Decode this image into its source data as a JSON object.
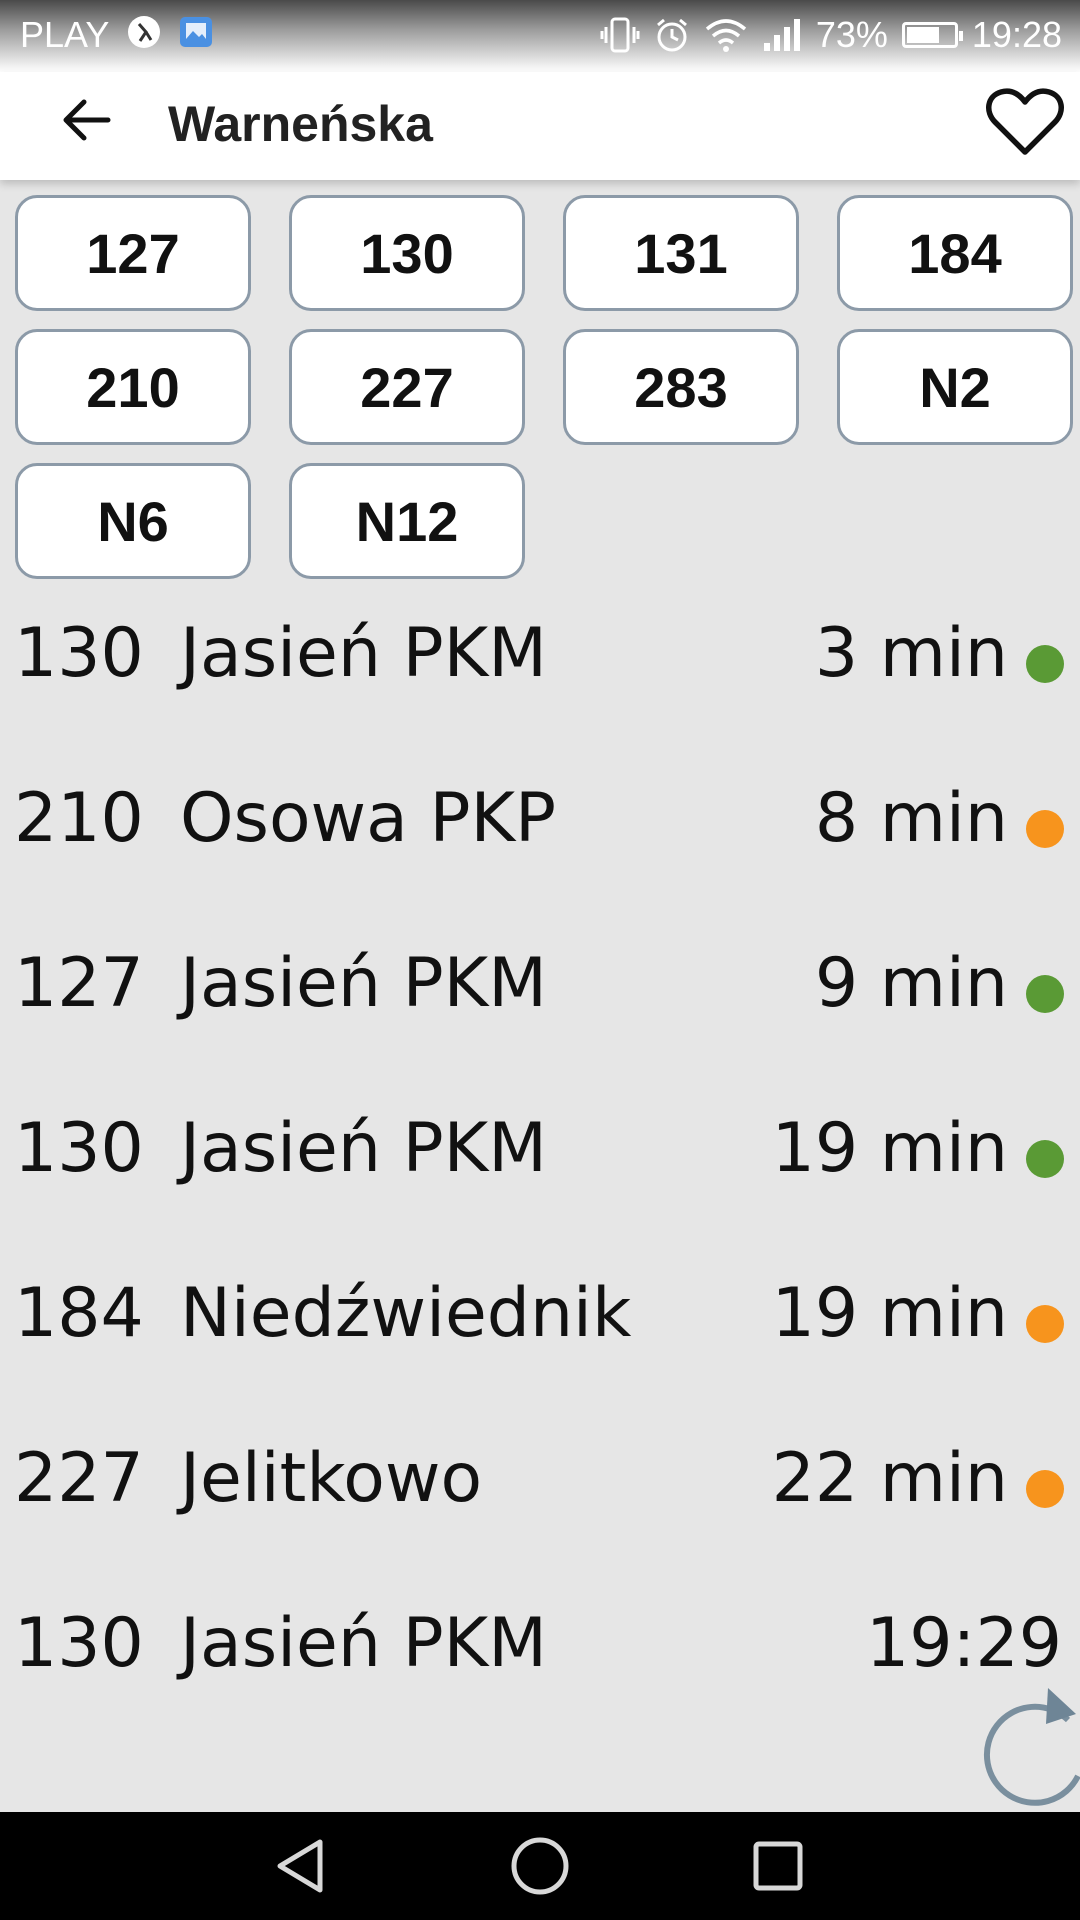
{
  "status_bar": {
    "carrier": "PLAY",
    "battery_percent": "73%",
    "battery_level": 0.73,
    "time": "19:28",
    "icons": [
      "cat-app-icon",
      "gallery-icon",
      "vibrate-icon",
      "alarm-icon",
      "wifi-icon",
      "signal-icon",
      "battery-icon"
    ]
  },
  "app_bar": {
    "title": "Warneńska",
    "back_icon": "arrow-left-icon",
    "favorite_icon": "heart-outline-icon"
  },
  "lines": [
    "127",
    "130",
    "131",
    "184",
    "210",
    "227",
    "283",
    "N2",
    "N6",
    "N12"
  ],
  "departures": [
    {
      "line": "130",
      "destination": "Jasień PKM",
      "time": "3 min",
      "status_color": "#5a9a35"
    },
    {
      "line": "210",
      "destination": "Osowa PKP",
      "time": "8 min",
      "status_color": "#f7941d"
    },
    {
      "line": "127",
      "destination": "Jasień PKM",
      "time": "9 min",
      "status_color": "#5a9a35"
    },
    {
      "line": "130",
      "destination": "Jasień PKM",
      "time": "19 min",
      "status_color": "#5a9a35"
    },
    {
      "line": "184",
      "destination": "Niedźwiednik",
      "time": "19 min",
      "status_color": "#f7941d"
    },
    {
      "line": "227",
      "destination": "Jelitkowo",
      "time": "22 min",
      "status_color": "#f7941d"
    },
    {
      "line": "130",
      "destination": "Jasień PKM",
      "time": "19:29",
      "status_color": null
    }
  ],
  "colors": {
    "on_time": "#5a9a35",
    "delayed": "#f7941d",
    "chip_border": "#8c9aa8",
    "refresh": "#6e8596"
  },
  "nav_bar": {
    "icons": [
      "nav-back-icon",
      "nav-home-icon",
      "nav-recents-icon"
    ]
  }
}
